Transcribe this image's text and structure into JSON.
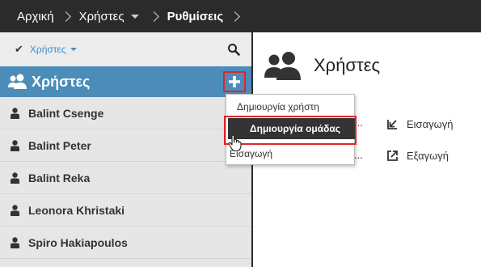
{
  "breadcrumb": {
    "home": "Αρχική",
    "users": "Χρήστες",
    "settings": "Ρυθμίσεις"
  },
  "sidebar": {
    "filter_label": "Χρήστες",
    "group_title": "Χρήστες",
    "users": [
      {
        "name": "Balint Csenge"
      },
      {
        "name": "Balint Peter"
      },
      {
        "name": "Balint Reka"
      },
      {
        "name": "Leonora Khristaki"
      },
      {
        "name": "Spiro Hakiapoulos"
      }
    ]
  },
  "dropdown": {
    "create_user": "Δημιουργία χρήστη",
    "create_group": "Δημιουργία ομάδας",
    "import": "Εισαγωγή"
  },
  "main": {
    "title": "Χρήστες",
    "import_label": "Εισαγωγή",
    "export_label": "Εξαγωγή"
  },
  "colors": {
    "topbar": "#2b2b2b",
    "group_header": "#4b8db8",
    "accent_blue": "#3d8ec9",
    "highlight_red": "#e0242a"
  }
}
